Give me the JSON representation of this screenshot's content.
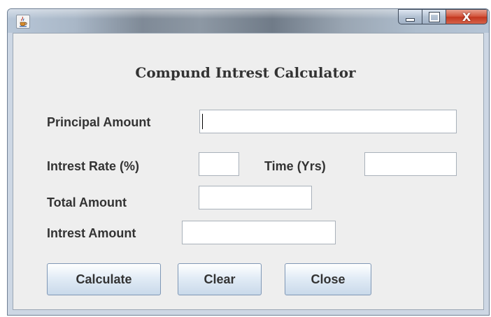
{
  "window": {
    "title_bar": {
      "app_icon": "java-cup-icon",
      "minimize_icon": "minimize-icon",
      "maximize_icon": "maximize-icon",
      "close_icon": "close-icon",
      "close_glyph": "X"
    }
  },
  "form": {
    "heading": "Compund Intrest Calculator",
    "principal": {
      "label": "Principal Amount",
      "value": ""
    },
    "rate": {
      "label": "Intrest Rate (%)",
      "value": ""
    },
    "time": {
      "label": "Time (Yrs)",
      "value": ""
    },
    "total": {
      "label": "Total Amount",
      "value": ""
    },
    "interest": {
      "label": "Intrest Amount",
      "value": ""
    }
  },
  "buttons": {
    "calculate": "Calculate",
    "clear": "Clear",
    "close": "Close"
  },
  "colors": {
    "text": "#333333",
    "panel": "#eeeeee",
    "close_button": "#c3371f",
    "button_top": "#ffffff",
    "button_bottom": "#c9d9ea"
  }
}
